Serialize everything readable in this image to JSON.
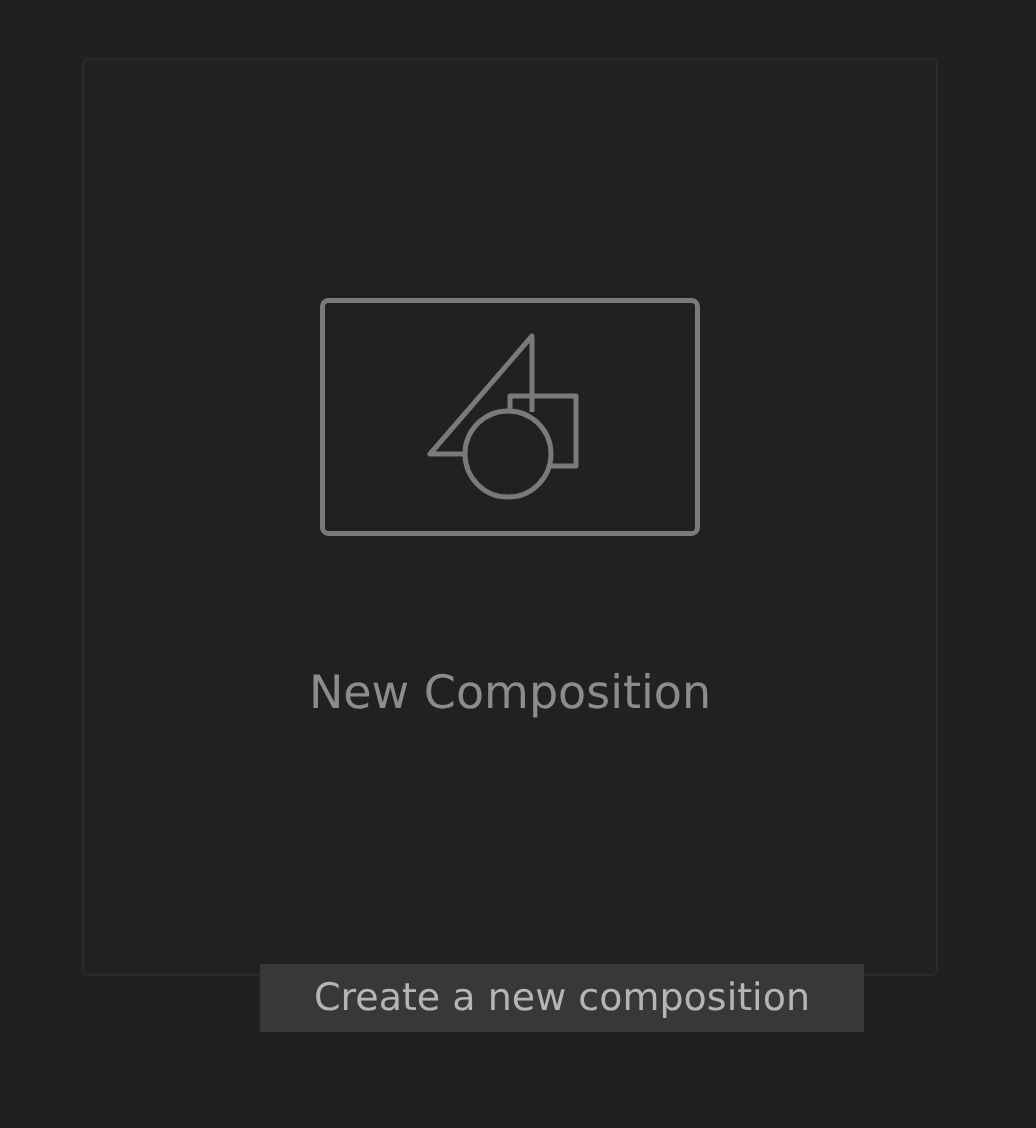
{
  "card": {
    "title": "New Composition"
  },
  "tooltip": {
    "text": "Create a new composition"
  }
}
